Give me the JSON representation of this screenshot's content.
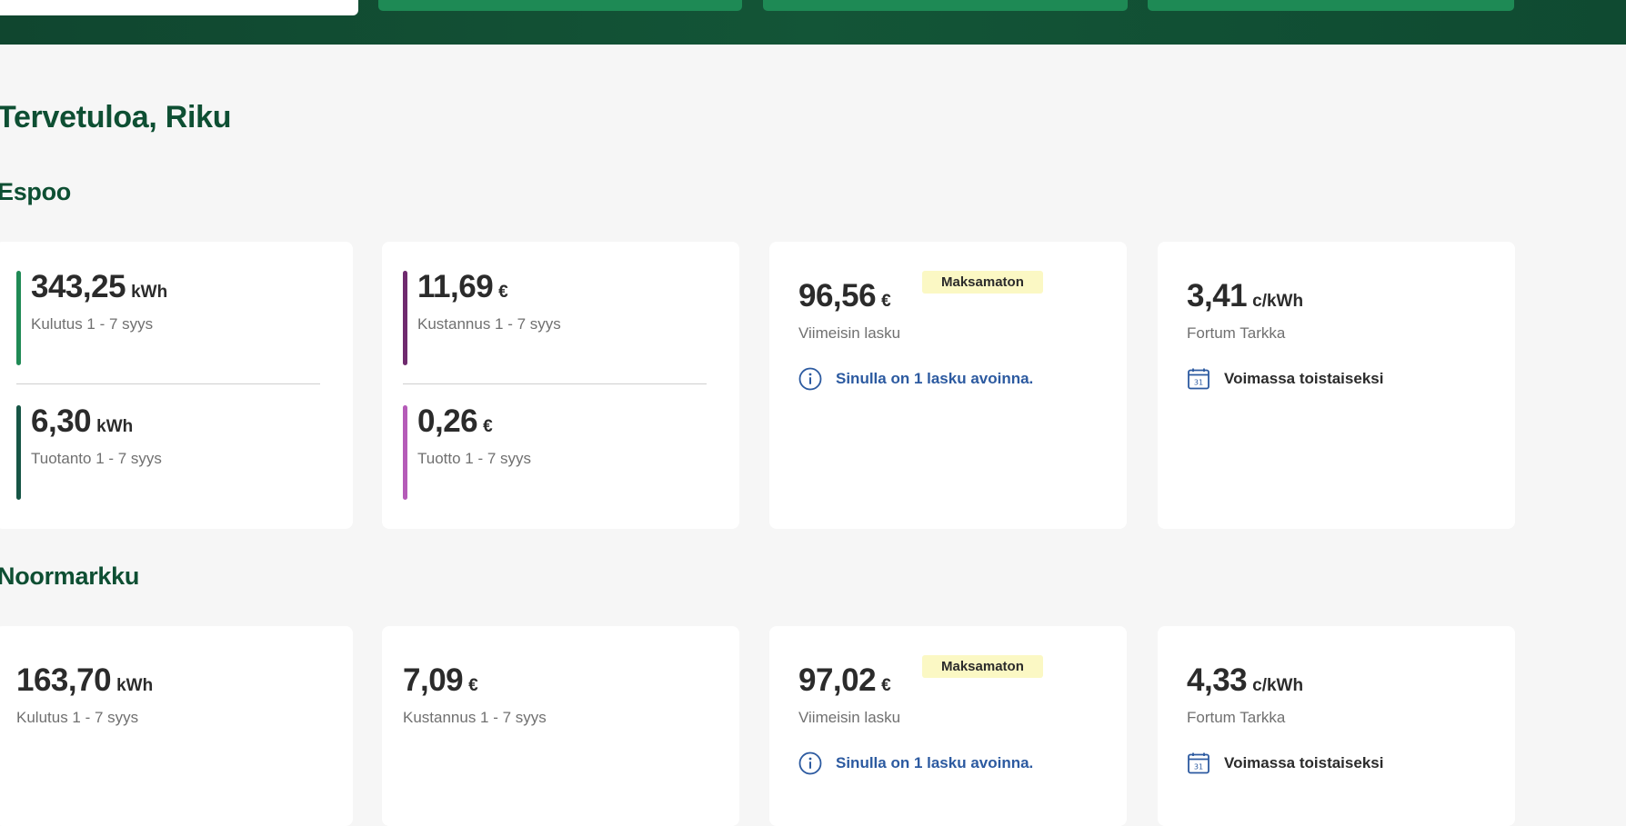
{
  "header": {
    "welcome": "Tervetuloa, Riku"
  },
  "sites": [
    {
      "name": "Espoo",
      "consumption": {
        "value": "343,25",
        "unit": "kWh",
        "label": "Kulutus 1 - 7 syys"
      },
      "production": {
        "value": "6,30",
        "unit": "kWh",
        "label": "Tuotanto 1 - 7 syys"
      },
      "cost": {
        "value": "11,69",
        "unit": "€",
        "label": "Kustannus 1 - 7 syys"
      },
      "revenue": {
        "value": "0,26",
        "unit": "€",
        "label": "Tuotto 1 - 7 syys"
      },
      "invoice": {
        "value": "96,56",
        "unit": "€",
        "label": "Viimeisin lasku",
        "status": "Maksamaton",
        "info": "Sinulla on 1 lasku avoinna."
      },
      "contract": {
        "value": "3,41",
        "unit": "c/kWh",
        "label": "Fortum Tarkka",
        "validity": "Voimassa toistaiseksi"
      }
    },
    {
      "name": "Noormarkku",
      "consumption": {
        "value": "163,70",
        "unit": "kWh",
        "label": "Kulutus 1 - 7 syys"
      },
      "cost": {
        "value": "7,09",
        "unit": "€",
        "label": "Kustannus 1 - 7 syys"
      },
      "invoice": {
        "value": "97,02",
        "unit": "€",
        "label": "Viimeisin lasku",
        "status": "Maksamaton",
        "info": "Sinulla on 1 lasku avoinna."
      },
      "contract": {
        "value": "4,33",
        "unit": "c/kWh",
        "label": "Fortum Tarkka",
        "validity": "Voimassa toistaiseksi"
      }
    }
  ],
  "colors": {
    "brand_dark": "#0e4f33",
    "consumption_bar": "#1f8a55",
    "production_bar": "#165545",
    "cost_bar": "#6f2a6e",
    "revenue_bar": "#b55bb8",
    "badge_bg": "#fbf8c4",
    "info_text": "#2c5aa0"
  },
  "icons": {
    "info": "info-circle-icon",
    "calendar": "calendar-icon"
  }
}
